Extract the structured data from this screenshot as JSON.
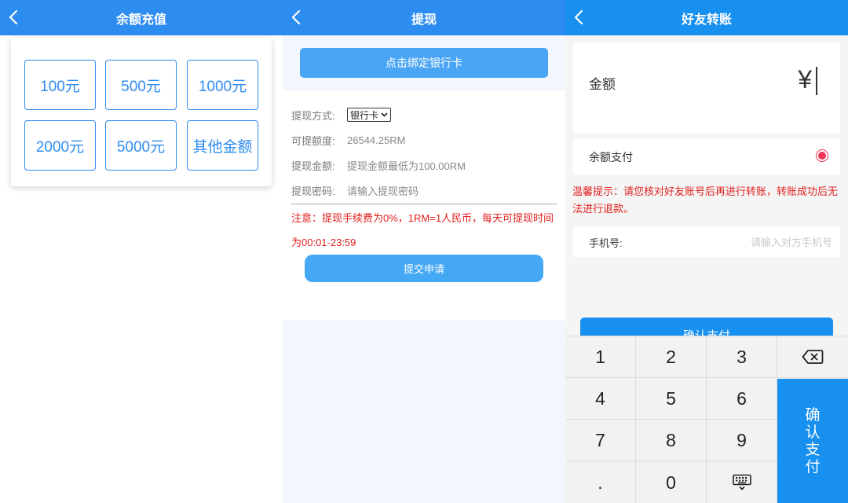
{
  "recharge": {
    "title": "余额充值",
    "amounts": [
      "100元",
      "500元",
      "1000元",
      "2000元",
      "5000元",
      "其他金额"
    ]
  },
  "withdraw": {
    "title": "提现",
    "bind_button": "点击绑定银行卡",
    "method_label": "提现方式:",
    "method_value": "银行卡",
    "available_label": "可提额度:",
    "available_value": "26544.25RM",
    "amount_label": "提现金额:",
    "amount_placeholder": "提现金额最低为100.00RM",
    "password_label": "提现密码:",
    "password_placeholder": "请输入提现密码",
    "note": "注意：提现手续费为0%，1RM=1人民币，每天可提现时间为00:01-23:59",
    "submit_button": "提交申请"
  },
  "transfer": {
    "title": "好友转账",
    "amount_label": "金额",
    "currency_symbol": "¥",
    "pay_method_label": "余额支付",
    "tip": "温馨提示：请您核对好友账号后再进行转账，转账成功后无法进行退款。",
    "phone_label": "手机号:",
    "phone_placeholder": "请输入对方手机号",
    "confirm_button": "确认支付",
    "keys": [
      "1",
      "2",
      "3",
      "4",
      "5",
      "6",
      "7",
      "8",
      "9",
      ".",
      "0"
    ],
    "keypad_confirm": "确认支付"
  },
  "icons": {
    "back": "chevron-left-icon",
    "backspace": "backspace-icon",
    "keyboard_hide": "keyboard-icon"
  },
  "colors": {
    "header_blue": "#2d8cf0",
    "header_blue_alt": "#1890f0",
    "button_blue": "#45a8f5",
    "warning_red": "#e02020",
    "radio_red": "#ee3355"
  }
}
